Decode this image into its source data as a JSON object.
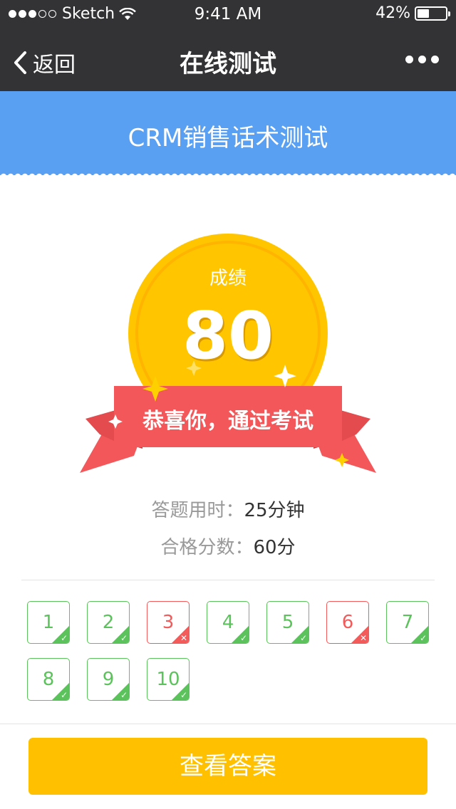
{
  "status_bar": {
    "carrier": "Sketch",
    "time": "9:41 AM",
    "battery": "42%",
    "battery_level": 0.42
  },
  "nav": {
    "back_label": "返回",
    "title": "在线测试"
  },
  "banner": {
    "title": "CRM销售话术测试"
  },
  "result": {
    "score_label": "成绩",
    "score": "80",
    "ribbon_text": "恭喜你，通过考试"
  },
  "info": {
    "time_label": "答题用时：",
    "time_value": "25分钟",
    "pass_label": "合格分数：",
    "pass_value": "60分"
  },
  "questions": [
    {
      "num": "1",
      "correct": true
    },
    {
      "num": "2",
      "correct": true
    },
    {
      "num": "3",
      "correct": false
    },
    {
      "num": "4",
      "correct": true
    },
    {
      "num": "5",
      "correct": true
    },
    {
      "num": "6",
      "correct": false
    },
    {
      "num": "7",
      "correct": true
    },
    {
      "num": "8",
      "correct": true
    },
    {
      "num": "9",
      "correct": true
    },
    {
      "num": "10",
      "correct": true
    }
  ],
  "button": {
    "label": "查看答案"
  },
  "colors": {
    "nav_bg": "#333336",
    "banner_bg": "#5aa0f2",
    "medal": "#ffc600",
    "ribbon": "#f3575a",
    "correct": "#5cc25b",
    "wrong": "#f35a5a",
    "button": "#ffc000"
  }
}
